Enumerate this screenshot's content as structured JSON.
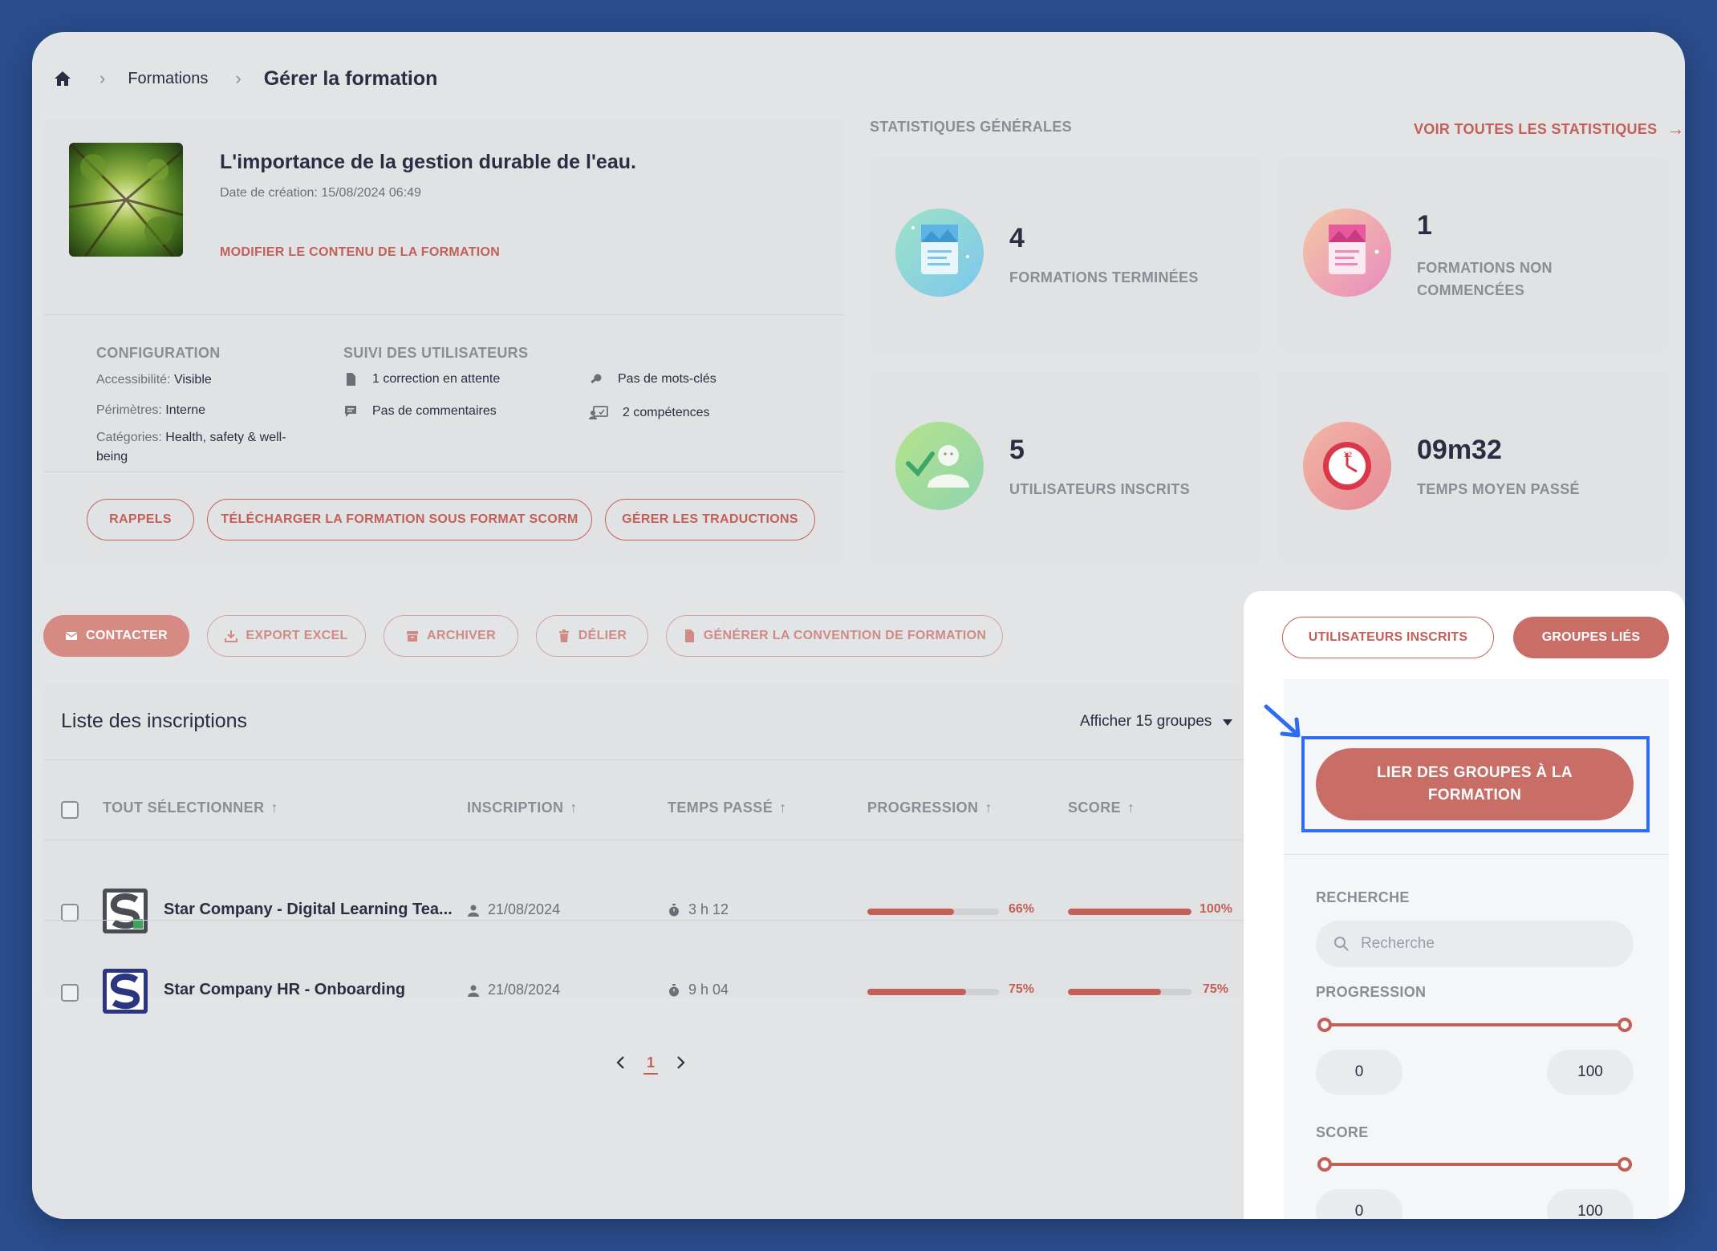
{
  "breadcrumb": {
    "home_icon": "home-icon",
    "items": [
      "Formations",
      "Gérer la formation"
    ]
  },
  "course": {
    "title": "L'importance de la gestion durable de l'eau.",
    "date": "Date de création: 15/08/2024 06:49",
    "edit_link": "MODIFIER LE CONTENU DE LA FORMATION",
    "configuration": {
      "heading": "CONFIGURATION",
      "accessibility_label": "Accessibilité:",
      "accessibility_value": "Visible",
      "perimeters_label": "Périmètres:",
      "perimeters_value": "Interne",
      "categories_label": "Catégories:",
      "categories_value_line1": "Health, safety & well-",
      "categories_value_line2": "being"
    },
    "suivi": {
      "heading": "SUIVI DES UTILISATEURS",
      "corrections": "1 correction en attente",
      "comments": "Pas de commentaires",
      "keywords": "Pas de mots-clés",
      "skills": "2 compétences"
    },
    "buttons": {
      "reminders": "RAPPELS",
      "scorm": "TÉLÉCHARGER LA FORMATION SOUS FORMAT SCORM",
      "translations": "GÉRER LES TRADUCTIONS"
    }
  },
  "stats": {
    "heading": "STATISTIQUES GÉNÉRALES",
    "link": "VOIR TOUTES LES STATISTIQUES",
    "cards": [
      {
        "value": "4",
        "label_line1": "FORMATIONS TERMINÉES",
        "label_line2": ""
      },
      {
        "value": "1",
        "label_line1": "FORMATIONS NON",
        "label_line2": "COMMENCÉES"
      },
      {
        "value": "5",
        "label_line1": "UTILISATEURS INSCRITS",
        "label_line2": ""
      },
      {
        "value": "09m32",
        "label_line1": "TEMPS MOYEN PASSÉ",
        "label_line2": ""
      }
    ]
  },
  "toolbar": {
    "contact": "CONTACTER",
    "export": "EXPORT EXCEL",
    "archive": "ARCHIVER",
    "unlink": "DÉLIER",
    "convention": "GÉNÉRER LA CONVENTION DE FORMATION"
  },
  "list": {
    "title": "Liste des inscriptions",
    "display_select": "Afficher 15 groupes",
    "columns": {
      "select_all": "TOUT SÉLECTIONNER",
      "inscription": "INSCRIPTION",
      "time": "TEMPS PASSÉ",
      "progress": "PROGRESSION",
      "score": "SCORE"
    },
    "rows": [
      {
        "name": "Star Company - Digital Learning Tea...",
        "date": "21/08/2024",
        "time": "3 h 12",
        "progress_label": "66%",
        "progress": 66,
        "score_label": "100%",
        "score": 100
      },
      {
        "name": "Star Company HR - Onboarding",
        "date": "21/08/2024",
        "time": "9 h 04",
        "progress_label": "75%",
        "progress": 75,
        "score_label": "75%",
        "score": 75
      }
    ],
    "pagination": {
      "current": "1"
    }
  },
  "side_panel": {
    "tab_users": "UTILISATEURS INSCRITS",
    "tab_groups": "GROUPES LIÉS",
    "link_groups_line1": "LIER DES GROUPES À LA",
    "link_groups_line2": "FORMATION",
    "search_label": "RECHERCHE",
    "search_placeholder": "Recherche",
    "progress_label": "PROGRESSION",
    "progress_min": "0",
    "progress_max": "100",
    "score_label": "SCORE",
    "score_min": "0",
    "score_max": "100"
  },
  "colors": {
    "accent": "#c45f58",
    "highlight": "#2c6df2",
    "background": "#2a4d8c"
  }
}
